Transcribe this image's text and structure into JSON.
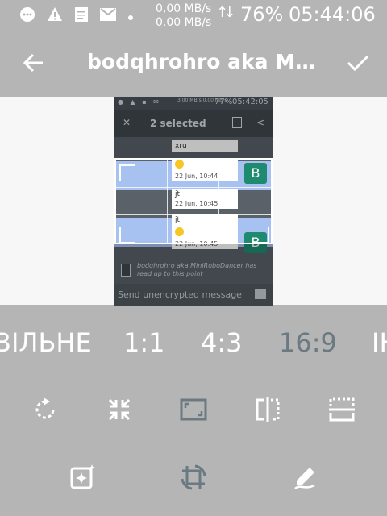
{
  "status_bar": {
    "speed_up": "0,00 MB/s",
    "speed_down": "0.00 MB/s",
    "battery": "76%",
    "time": "05:44:06",
    "icons": [
      "chat-icon",
      "warning-icon",
      "document-icon",
      "mail-icon",
      "dot-icon"
    ]
  },
  "app_bar": {
    "title": "bodqhrohro aka Mi...",
    "back_icon": "arrow-left-icon",
    "confirm_icon": "check-icon"
  },
  "preview": {
    "status_battery": "77%",
    "status_time": "05:42:05",
    "status_speed": "3.00 MB/s 0.00 MB/s",
    "selected_label": "2 selected",
    "messages": [
      {
        "text": "xru",
        "time": ""
      },
      {
        "text": "",
        "time": "22 Jun, 10:44"
      },
      {
        "text": "jt",
        "time": "22 Jun, 10:45"
      },
      {
        "text": "jt",
        "time": ""
      },
      {
        "text": "",
        "time": "22 Jun, 10:45"
      }
    ],
    "read_notice": "bodqhrohro aka MiniRoboDancer has read up to this point",
    "input_placeholder": "Send unencrypted message"
  },
  "aspect_ratios": {
    "options": [
      "ВІЛЬНЕ",
      "1:1",
      "4:3",
      "16:9",
      "ІН"
    ],
    "selected": "16:9"
  },
  "tools": {
    "row1": [
      "rotate-icon",
      "shrink-icon",
      "aspect-icon",
      "flip-horizontal-icon",
      "flip-vertical-icon"
    ],
    "row2": [
      "auto-enhance-icon",
      "crop-rotate-icon",
      "draw-icon"
    ]
  },
  "colors": {
    "background": "#b5b5b5",
    "canvas": "#f7f7f7",
    "selection": "#a7c1f0",
    "avatar": "#1e8b70",
    "ratio_active": "#6b7a82"
  }
}
